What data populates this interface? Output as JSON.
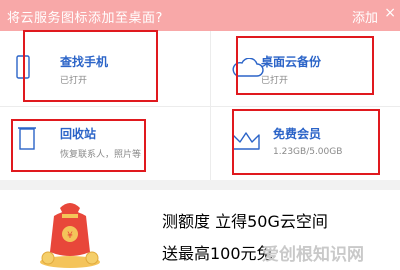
{
  "banner": {
    "text": "将云服务图标添加至桌面?",
    "add_label": "添加",
    "close_symbol": "×"
  },
  "features": [
    {
      "title": "查找手机",
      "subtitle": "已打开",
      "icon": "phone-icon"
    },
    {
      "title": "桌面云备份",
      "subtitle": "已打开",
      "icon": "cloud-icon"
    },
    {
      "title": "回收站",
      "subtitle": "恢复联系人，照片等",
      "icon": "trash-icon"
    },
    {
      "title": "免费会员",
      "subtitle": "1.23GB/5.00GB",
      "icon": "crown-icon"
    }
  ],
  "promo": {
    "headline": "测额度 立得50G云空间",
    "tagline": "送最高100元免",
    "image": "gift-bag-icon"
  },
  "watermark": "爱创根知识网",
  "colors": {
    "banner": "#f8a8a8",
    "title_blue": "#2b64c8",
    "promo_blue": "#4a8fe0",
    "promo_orange": "#f3a64a",
    "highlight_red": "#e0191e"
  }
}
